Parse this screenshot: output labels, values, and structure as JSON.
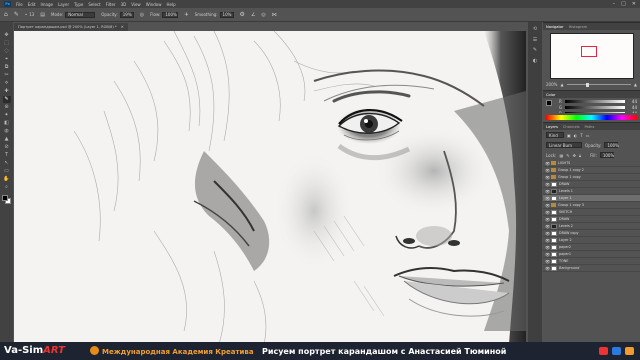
{
  "menubar": {
    "logo": "Ps",
    "items": [
      "File",
      "Edit",
      "Image",
      "Layer",
      "Type",
      "Select",
      "Filter",
      "3D",
      "View",
      "Window",
      "Help"
    ],
    "window_controls": [
      "–",
      "□",
      "✕"
    ]
  },
  "options": {
    "brush_size": "13",
    "mode_label": "Mode:",
    "mode_value": "Normal",
    "opacity_label": "Opacity:",
    "opacity_value": "19%",
    "flow_label": "Flow:",
    "flow_value": "100%",
    "smoothing_label": "Smoothing:",
    "smoothing_value": "10%"
  },
  "document": {
    "tab_label": "Портрет карандашом.psd @ 200% (Layer 1, RGB/8) *"
  },
  "toolbar": {
    "tools": [
      "✥",
      "⬚",
      "◌",
      "⌖",
      "⧉",
      "✂",
      "⟡",
      "✚",
      "✎",
      "⊛",
      "✦",
      "◧",
      "◍",
      "▲",
      "⊘",
      "T",
      "↖",
      "▭",
      "✋",
      "⌕"
    ],
    "active_index": 8
  },
  "navigator": {
    "tabs": [
      "Navigator",
      "Histogram"
    ],
    "zoom": "200%"
  },
  "color": {
    "tab": "Color",
    "rows": [
      {
        "label": "R",
        "value": "44"
      },
      {
        "label": "G",
        "value": "44"
      },
      {
        "label": "B",
        "value": "44"
      }
    ]
  },
  "layers": {
    "tabs": [
      "Layers",
      "Channels",
      "Paths"
    ],
    "kind_label": "Kind",
    "blend_mode": "Linear Burn",
    "opacity_label": "Opacity:",
    "opacity_value": "100%",
    "lock_label": "Lock:",
    "fill_label": "Fill:",
    "fill_value": "100%",
    "items": [
      {
        "name": "LIGHTS",
        "type": "folder"
      },
      {
        "name": "Group 1 copy 2",
        "type": "folder"
      },
      {
        "name": "Group 1 copy",
        "type": "folder"
      },
      {
        "name": "DRAW",
        "type": "layer"
      },
      {
        "name": "Levels 1",
        "type": "adjust"
      },
      {
        "name": "Layer 1",
        "type": "layer",
        "selected": true
      },
      {
        "name": "Group 1 copy 3",
        "type": "folder"
      },
      {
        "name": "SKETCH",
        "type": "layer"
      },
      {
        "name": "DRAW",
        "type": "layer"
      },
      {
        "name": "Levels 2",
        "type": "adjust"
      },
      {
        "name": "DRAW copy",
        "type": "layer"
      },
      {
        "name": "Layer 2",
        "type": "layer"
      },
      {
        "name": "paper2",
        "type": "layer"
      },
      {
        "name": "paper1",
        "type": "layer"
      },
      {
        "name": "TONE",
        "type": "layer"
      },
      {
        "name": "Background",
        "type": "layer"
      }
    ]
  },
  "footer": {
    "brand": "Va-Sim",
    "brand_suffix": "ART",
    "academy": "Международная Академия Креатива",
    "course_title": "Рисуем портрет карандашом с Анастасией Тюминой"
  }
}
